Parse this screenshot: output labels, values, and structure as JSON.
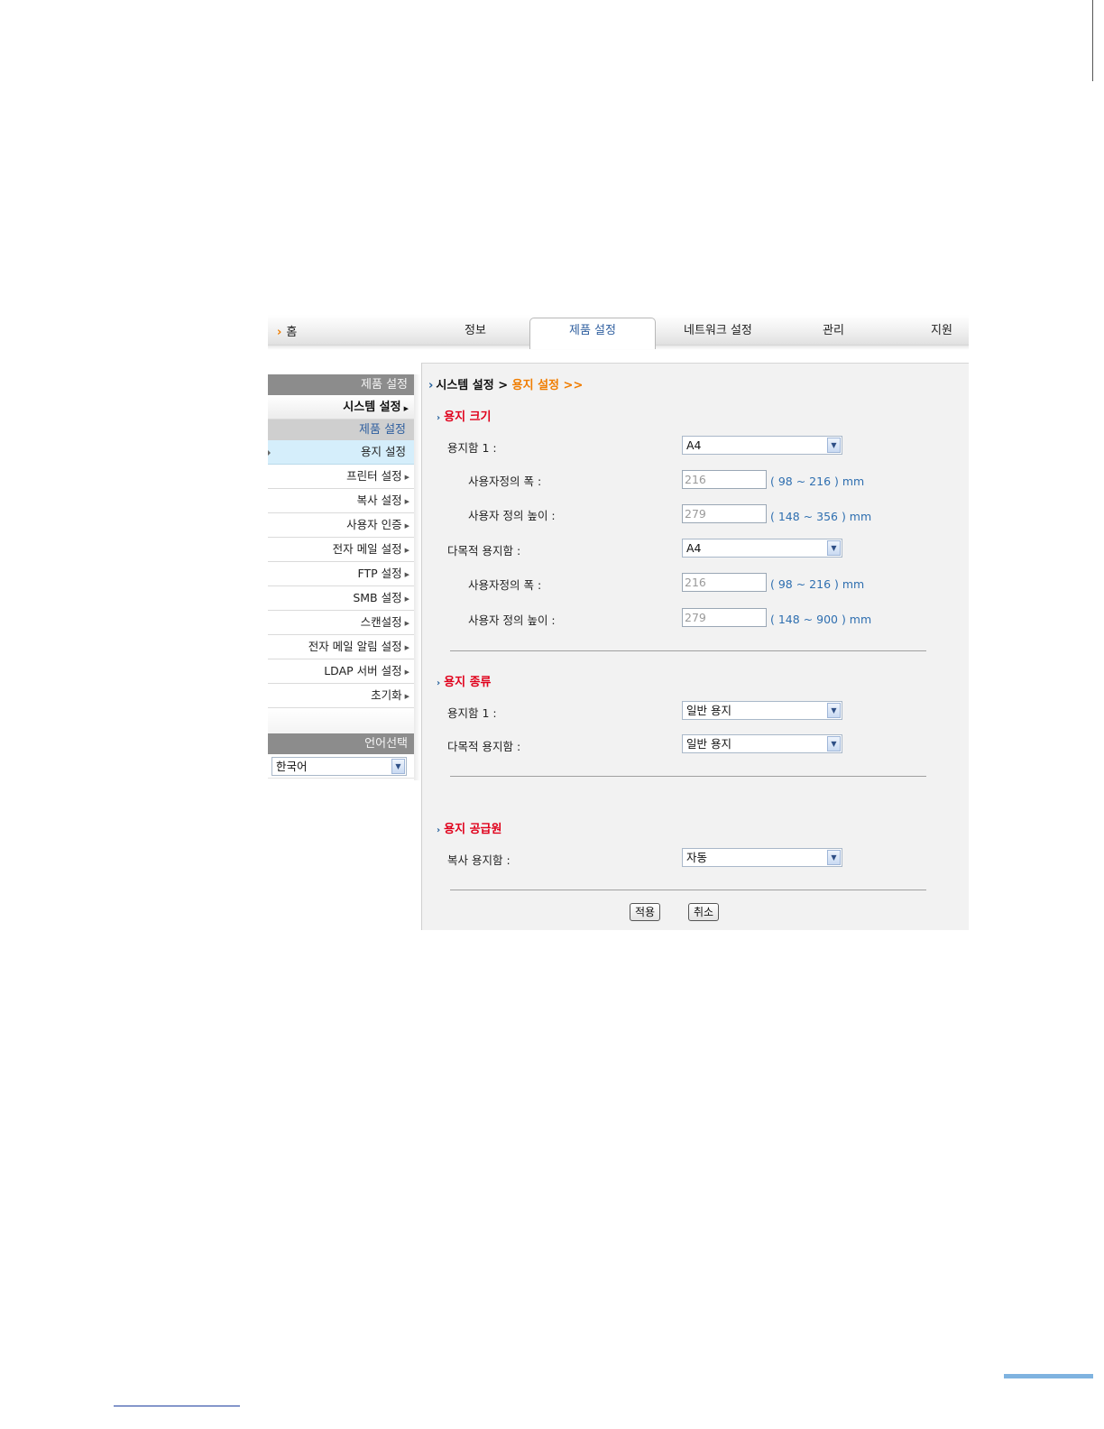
{
  "nav": {
    "home": "홈",
    "tabs": [
      "정보",
      "제품 설정",
      "네트워크 설정",
      "관리",
      "지원"
    ]
  },
  "sidebar": {
    "header": "제품 설정",
    "system": "시스템 설정",
    "subheader": "제품 설정",
    "items": [
      "용지 설정",
      "프린터 설정",
      "복사 설정",
      "사용자 인증",
      "전자 메일 설정",
      "FTP 설정",
      "SMB 설정",
      "스캔설정",
      "전자 메일 알림 설정",
      "LDAP 서버 설정",
      "초기화"
    ],
    "active_index": 0,
    "language_header": "언어선택",
    "language_value": "한국어"
  },
  "breadcrumb": {
    "parent": "시스템 설정",
    "separator": ">",
    "current": "용지 설정 >>"
  },
  "paper_size": {
    "title": "용지 크기",
    "tray1_label": "용지함 1 :",
    "tray1_value": "A4",
    "tray1_width_label": "사용자정의 폭 :",
    "tray1_width_value": "216",
    "tray1_width_range": "( 98 ~ 216 ) mm",
    "tray1_height_label": "사용자 정의 높이 :",
    "tray1_height_value": "279",
    "tray1_height_range": "( 148 ~ 356 ) mm",
    "mp_label": "다목적 용지함 :",
    "mp_value": "A4",
    "mp_width_label": "사용자정의 폭 :",
    "mp_width_value": "216",
    "mp_width_range": "( 98 ~ 216 ) mm",
    "mp_height_label": "사용자 정의 높이 :",
    "mp_height_value": "279",
    "mp_height_range": "( 148 ~ 900 ) mm"
  },
  "paper_type": {
    "title": "용지 종류",
    "tray1_label": "용지함 1 :",
    "tray1_value": "일반 용지",
    "mp_label": "다목적 용지함 :",
    "mp_value": "일반 용지"
  },
  "paper_source": {
    "title": "용지 공급원",
    "copy_tray_label": "복사 용지함 :",
    "copy_tray_value": "자동"
  },
  "buttons": {
    "apply": "적용",
    "cancel": "취소"
  }
}
